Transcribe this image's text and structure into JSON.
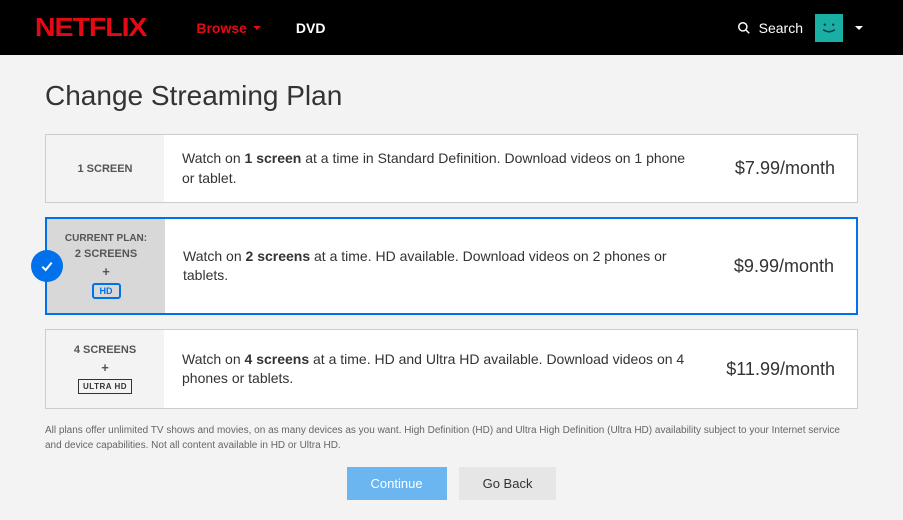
{
  "header": {
    "logo": "NETFLIX",
    "browse": "Browse",
    "dvd": "DVD",
    "search": "Search"
  },
  "page": {
    "title": "Change Streaming Plan"
  },
  "plans": [
    {
      "label": "1 SCREEN",
      "desc_pre": "Watch on ",
      "desc_bold": "1 screen",
      "desc_post": " at a time in Standard Definition. Download videos on 1 phone or tablet.",
      "price": "$7.99/month"
    },
    {
      "current_label": "CURRENT PLAN:",
      "label": "2 SCREENS",
      "desc_pre": "Watch on ",
      "desc_bold": "2 screens",
      "desc_post": " at a time. HD available. Download videos on 2 phones or tablets.",
      "price": "$9.99/month",
      "hd_badge": "HD"
    },
    {
      "label": "4 SCREENS",
      "desc_pre": "Watch on ",
      "desc_bold": "4 screens",
      "desc_post": " at a time. HD and Ultra HD available. Download videos on 4 phones or tablets.",
      "price": "$11.99/month",
      "ultrahd_badge": "ULTRA HD"
    }
  ],
  "disclaimer": "All plans offer unlimited TV shows and movies, on as many devices as you want. High Definition (HD) and Ultra High Definition (Ultra HD) availability subject to your Internet service and device capabilities. Not all content available in HD or Ultra HD.",
  "buttons": {
    "continue": "Continue",
    "goback": "Go Back"
  }
}
